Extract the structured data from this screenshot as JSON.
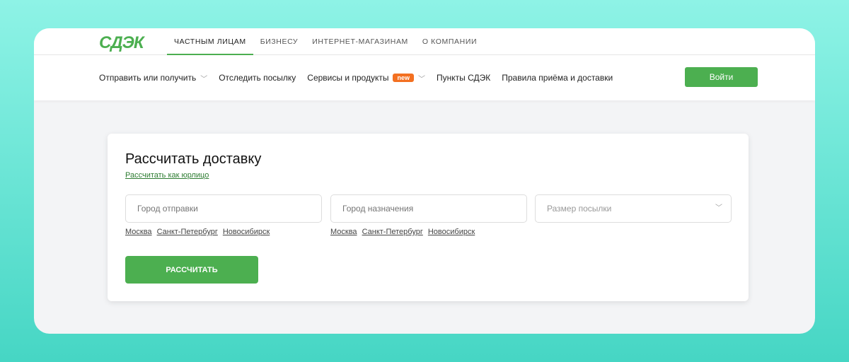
{
  "logo": "СДЭК",
  "top_tabs": [
    "ЧАСТНЫМ ЛИЦАМ",
    "БИЗНЕСУ",
    "ИНТЕРНЕТ-МАГАЗИНАМ",
    "О КОМПАНИИ"
  ],
  "nav": {
    "send": "Отправить или получить",
    "track": "Отследить посылку",
    "services": "Сервисы и продукты",
    "badge": "new",
    "points": "Пункты СДЭК",
    "rules": "Правила приёма и доставки",
    "login": "Войти"
  },
  "calc": {
    "title": "Рассчитать доставку",
    "legal": "Рассчитать как юрлицо",
    "from_placeholder": "Город отправки",
    "to_placeholder": "Город назначения",
    "size_placeholder": "Размер посылки",
    "cities": [
      "Москва",
      "Санкт-Петербург",
      "Новосибирск"
    ],
    "button": "РАССЧИТАТЬ"
  }
}
